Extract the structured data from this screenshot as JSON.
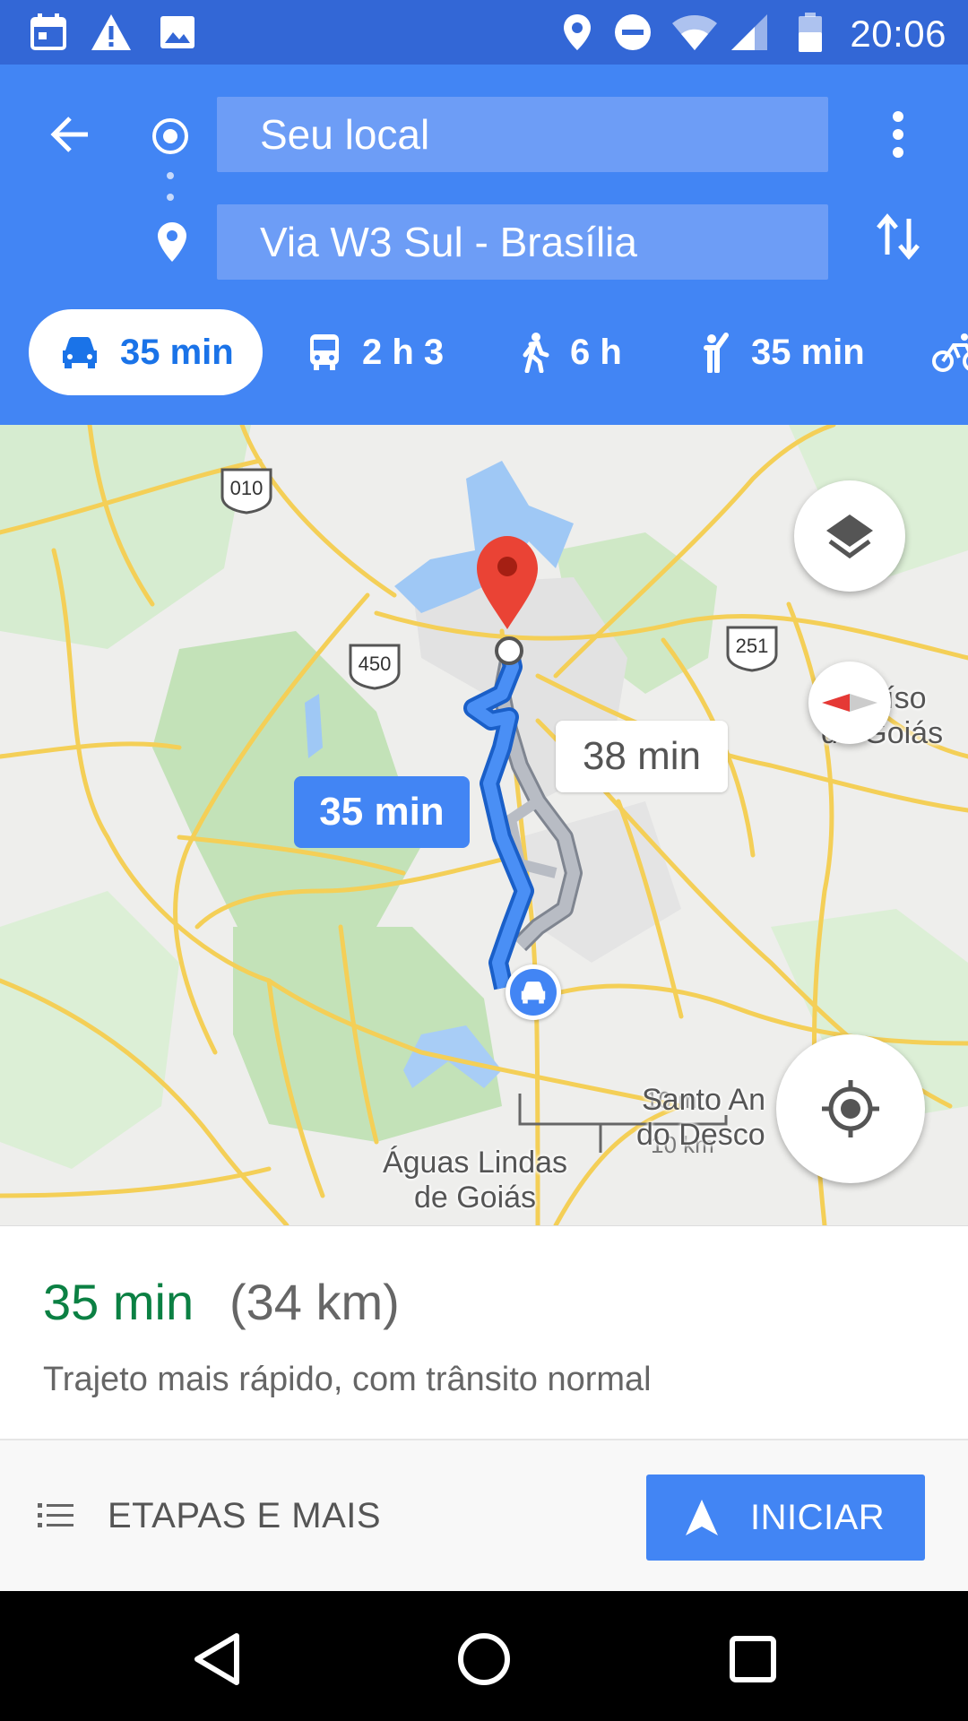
{
  "status_bar": {
    "time": "20:06",
    "left_icons": [
      "calendar-icon",
      "warning-icon",
      "image-icon"
    ],
    "right_icons": [
      "location-icon",
      "do-not-disturb-icon",
      "wifi-icon",
      "signal-icon",
      "battery-icon"
    ]
  },
  "header": {
    "origin": "Seu local",
    "destination": "Via W3 Sul - Brasília"
  },
  "modes": [
    {
      "icon": "car-icon",
      "label": "35 min",
      "selected": true
    },
    {
      "icon": "transit-icon",
      "label": "2 h 3"
    },
    {
      "icon": "walk-icon",
      "label": "6 h"
    },
    {
      "icon": "ride-hail-icon",
      "label": "35 min"
    },
    {
      "icon": "bike-icon",
      "label": ""
    }
  ],
  "map": {
    "route_primary_label": "35 min",
    "route_alt_label": "38 min",
    "highway_shields": [
      "010",
      "450",
      "251"
    ],
    "places": {
      "aguas_lindas_1": "Águas Lindas",
      "aguas_lindas_2": "de Goiás",
      "paraiso_1": "raíso",
      "paraiso_2": "de Goiás",
      "santo_1": "Santo An",
      "santo_2": "do Desco"
    },
    "scale_top": "10 mi",
    "scale_bottom": "10 km"
  },
  "summary": {
    "duration": "35 min",
    "distance": "(34 km)",
    "description": "Trajeto mais rápido, com trânsito normal"
  },
  "actions": {
    "steps_label": "ETAPAS E MAIS",
    "start_label": "INICIAR"
  },
  "colors": {
    "header": "#4285f4",
    "status_bar": "#3367d6",
    "route": "#4285f4",
    "duration_green": "#0b8043"
  }
}
